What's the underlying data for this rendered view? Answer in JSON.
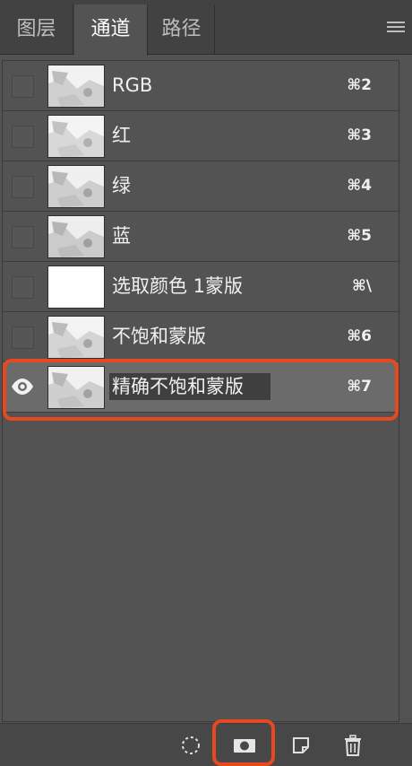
{
  "tabs": [
    {
      "label": "图层"
    },
    {
      "label": "通道"
    },
    {
      "label": "路径"
    }
  ],
  "active_tab": "通道",
  "channels": [
    {
      "name": "RGB",
      "shortcut": "⌘2",
      "visible": false
    },
    {
      "name": "红",
      "shortcut": "⌘3",
      "visible": false
    },
    {
      "name": "绿",
      "shortcut": "⌘4",
      "visible": false
    },
    {
      "name": "蓝",
      "shortcut": "⌘5",
      "visible": false
    },
    {
      "name": "选取颜色 1蒙版",
      "shortcut": "⌘\\",
      "visible": false
    },
    {
      "name": "不饱和蒙版",
      "shortcut": "⌘6",
      "visible": false
    },
    {
      "name": "精确不饱和蒙版",
      "shortcut": "⌘7",
      "visible": true,
      "selected": true
    }
  ],
  "bottom_tools": [
    {
      "icon": "load-selection-icon"
    },
    {
      "icon": "save-selection-as-channel-icon"
    },
    {
      "icon": "new-channel-icon"
    },
    {
      "icon": "trash-icon"
    }
  ],
  "highlight_color": "#e8481f"
}
